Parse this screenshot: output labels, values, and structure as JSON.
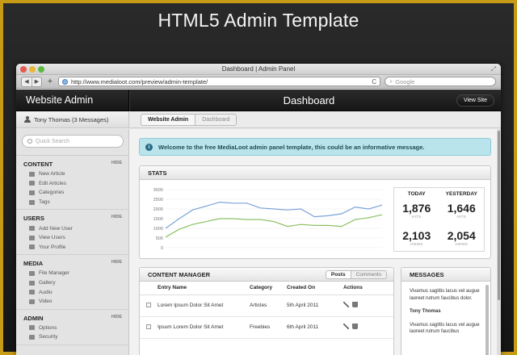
{
  "hero": {
    "title": "HTML5 Admin Template"
  },
  "browser": {
    "window_title": "Dashboard | Admin Panel",
    "url": "http://www.medialoot.com/preview/admin-template/",
    "search_placeholder": "Google",
    "back": "◀",
    "forward": "▶",
    "plus": "+",
    "reload": "C"
  },
  "header": {
    "site_title": "Website Admin",
    "page_title": "Dashboard",
    "view_site": "View Site"
  },
  "user": {
    "label": "Tony Thomas (3 Messages)"
  },
  "breadcrumb": [
    "Website Admin",
    "Dashboard"
  ],
  "sidebar": {
    "search_placeholder": "Quick Search",
    "hide_label": "HIDE",
    "sections": [
      {
        "title": "CONTENT",
        "items": [
          "New Article",
          "Edit Articles",
          "Categories",
          "Tags"
        ]
      },
      {
        "title": "USERS",
        "items": [
          "Add New User",
          "View Users",
          "Your Profile"
        ]
      },
      {
        "title": "MEDIA",
        "items": [
          "File Manager",
          "Gallery",
          "Audio",
          "Video"
        ]
      },
      {
        "title": "ADMIN",
        "items": [
          "Options",
          "Security"
        ]
      }
    ]
  },
  "alert": {
    "message": "Welcome to the free MediaLoot admin panel template, this could be an informative message."
  },
  "stats": {
    "title": "STATS",
    "today": "TODAY",
    "yesterday": "YESTERDAY",
    "today_hits": "1,876",
    "yesterday_hits": "1,646",
    "today_views": "2,103",
    "yesterday_views": "2,054",
    "hits_label": "HITS",
    "views_label": "VIEWS"
  },
  "chart_data": {
    "type": "line",
    "ylim": [
      0,
      3000
    ],
    "yticks": [
      "3000",
      "2500",
      "2000",
      "1500",
      "1000",
      "500",
      "0"
    ],
    "series": [
      {
        "color": "#7aa3d6",
        "values": [
          1000,
          1500,
          1950,
          2150,
          2350,
          2300,
          2300,
          2050,
          2000,
          1950,
          2000,
          1600,
          1650,
          1750,
          2100,
          2000,
          2200
        ]
      },
      {
        "color": "#8cc063",
        "values": [
          550,
          950,
          1200,
          1350,
          1500,
          1500,
          1450,
          1450,
          1350,
          1100,
          1200,
          1150,
          1150,
          1100,
          1450,
          1550,
          1700
        ]
      }
    ]
  },
  "content_manager": {
    "title": "CONTENT MANAGER",
    "tabs": [
      "Posts",
      "Comments"
    ],
    "columns": [
      "Entry Name",
      "Category",
      "Created On",
      "Actions"
    ],
    "rows": [
      {
        "name": "Lorem Ipsum Dolor Sit Amet",
        "category": "Articles",
        "date": "5th April 2011"
      },
      {
        "name": "Ipsum Lorem Dolor Sit Amet",
        "category": "Freebies",
        "date": "6th April 2011"
      }
    ]
  },
  "messages": {
    "title": "MESSAGES",
    "text1": "Vivamus sagittis lacus vel augue laoreet rutrum faucibus dolor.",
    "author": "Tony Thomas",
    "text2": "Vivamus sagittis lacus vel augue laoreet rutrum faucibus"
  }
}
